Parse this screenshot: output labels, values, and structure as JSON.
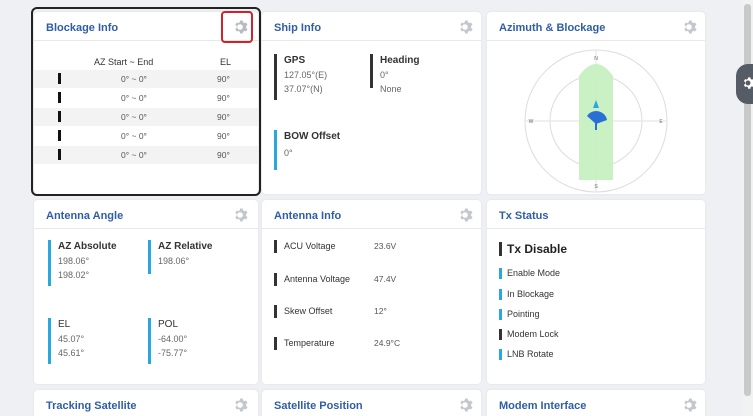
{
  "panels": {
    "blockage_info": {
      "title": "Blockage Info",
      "col_az": "AZ Start ~ End",
      "col_el": "EL",
      "rows": [
        {
          "az": "0° ~ 0°",
          "el": "90°"
        },
        {
          "az": "0° ~ 0°",
          "el": "90°"
        },
        {
          "az": "0° ~ 0°",
          "el": "90°"
        },
        {
          "az": "0° ~ 0°",
          "el": "90°"
        },
        {
          "az": "0° ~ 0°",
          "el": "90°"
        }
      ]
    },
    "ship_info": {
      "title": "Ship Info",
      "gps_label": "GPS",
      "gps_lon": "127.05°(E)",
      "gps_lat": "37.07°(N)",
      "heading_label": "Heading",
      "heading_value": "0°",
      "heading_source": "None",
      "bow_label": "BOW Offset",
      "bow_value": "0°"
    },
    "azimuth_blockage": {
      "title": "Azimuth & Blockage",
      "compass_n": "N",
      "compass_s": "S",
      "compass_e": "E",
      "compass_w": "W"
    },
    "antenna_angle": {
      "title": "Antenna Angle",
      "az_abs_label": "AZ Absolute",
      "az_abs_v1": "198.06°",
      "az_abs_v2": "198.02°",
      "az_rel_label": "AZ Relative",
      "az_rel_v1": "198.06°",
      "el_label": "EL",
      "el_v1": "45.07°",
      "el_v2": "45.61°",
      "pol_label": "POL",
      "pol_v1": "-64.00°",
      "pol_v2": "-75.77°"
    },
    "antenna_info": {
      "title": "Antenna Info",
      "rows": [
        {
          "label": "ACU Voltage",
          "value": "23.6V"
        },
        {
          "label": "Antenna Voltage",
          "value": "47.4V"
        },
        {
          "label": "Skew Offset",
          "value": "12°"
        },
        {
          "label": "Temperature",
          "value": "24.9°C"
        }
      ]
    },
    "tx_status": {
      "title": "Tx Status",
      "state": "Tx Disable",
      "items": [
        "Enable Mode",
        "In Blockage",
        "Pointing",
        "Modem Lock",
        "LNB Rotate"
      ],
      "item_colors": [
        "#29a8df",
        "#29a8df",
        "#29a8df",
        "#333333",
        "#29a8df"
      ]
    },
    "tracking_satellite": {
      "title": "Tracking Satellite"
    },
    "satellite_position": {
      "title": "Satellite Position"
    },
    "modem_interface": {
      "title": "Modem Interface"
    }
  },
  "colors": {
    "accent": "#2f5ea5",
    "indicator_blue": "#29a8df",
    "blockage_green": "#c6f0c0",
    "highlight_red": "#d0222a"
  },
  "icons": [
    "gear-icon",
    "compass-icon",
    "antenna-dish-icon",
    "settings-gear-icon"
  ]
}
